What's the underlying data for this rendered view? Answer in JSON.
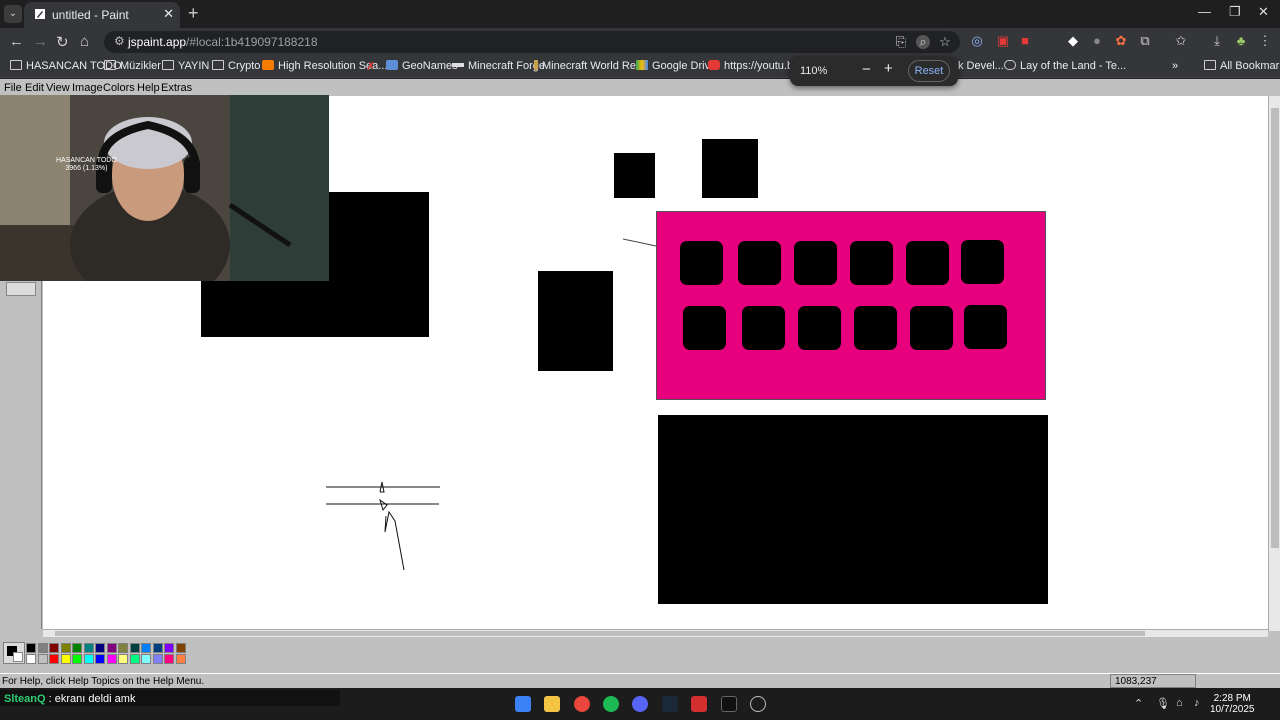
{
  "browser": {
    "tab_title": "untitled - Paint",
    "url_host": "jspaint.app",
    "url_path": "/#local:1b419097188218",
    "bookmarks": [
      {
        "label": "HASANCAN TODO",
        "icon": "folder-icon"
      },
      {
        "label": "Müzikler",
        "icon": "folder-icon"
      },
      {
        "label": "YAYIN",
        "icon": "folder-icon"
      },
      {
        "label": "Crypto",
        "icon": "folder-icon"
      },
      {
        "label": "High Resolution Sea...",
        "icon": "blogger-icon"
      },
      {
        "label": "",
        "icon": "x-icon"
      },
      {
        "label": "GeoNames",
        "icon": "globe-icon"
      },
      {
        "label": "Minecraft Forge",
        "icon": "anvil-icon"
      },
      {
        "label": "Minecraft World Re...",
        "icon": "torch-icon"
      },
      {
        "label": "Google Drive",
        "icon": "drive-icon"
      },
      {
        "label": "https://youtu.be/W",
        "icon": "youtube-icon"
      },
      {
        "label": "k Devel...",
        "icon": "page-icon"
      },
      {
        "label": "Lay of the Land - Te...",
        "icon": "globe-icon"
      }
    ],
    "all_bookmarks_label": "All Bookmarks",
    "zoom_popup": {
      "percent": "110%",
      "minus": "−",
      "plus": "+",
      "reset_label": "Reset"
    }
  },
  "paint": {
    "menu": [
      "File",
      "Edit",
      "View",
      "Image",
      "Colors",
      "Help",
      "Extras"
    ],
    "status_text": "For Help, click Help Topics on the Help Menu.",
    "cursor_coords": "1083,237",
    "palette_colors": [
      "#000000",
      "#808080",
      "#800000",
      "#808000",
      "#008000",
      "#008080",
      "#000080",
      "#800080",
      "#808040",
      "#004040",
      "#0080ff",
      "#004080",
      "#8000ff",
      "#804000",
      "#ffffff",
      "#c0c0c0",
      "#ff0000",
      "#ffff00",
      "#00ff00",
      "#00ffff",
      "#0000ff",
      "#ff00ff",
      "#ffff80",
      "#00ff80",
      "#80ffff",
      "#8080ff",
      "#ff0080",
      "#ff8040"
    ],
    "canvas_accent": "#e6007e"
  },
  "webcam_overlay": {
    "label_line1": "HASANCAN TODO",
    "label_line2": "3966 (1.13%)"
  },
  "taskbar": {
    "chat_user": "SlteanQ",
    "chat_message": " : ekranı deldi amk",
    "time": "2:28 PM",
    "date": "10/7/2025"
  }
}
